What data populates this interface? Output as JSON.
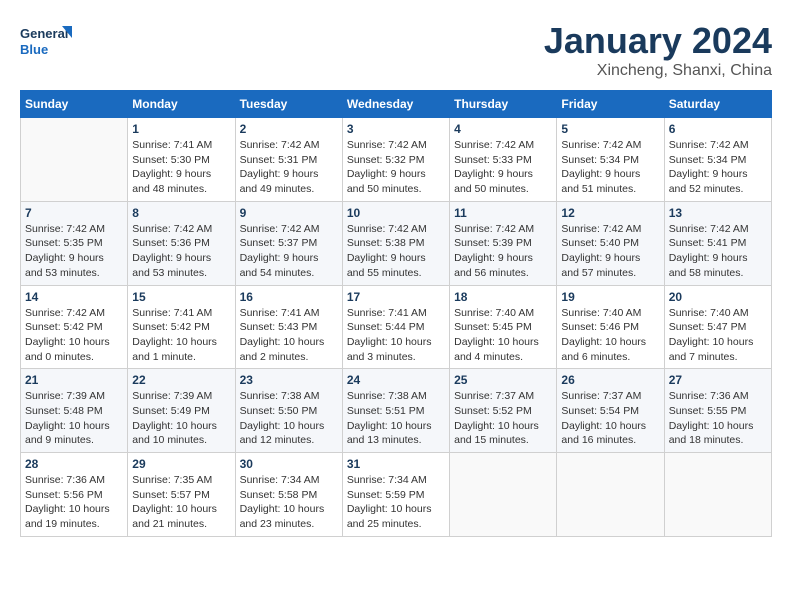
{
  "logo": {
    "general": "General",
    "blue": "Blue"
  },
  "title": "January 2024",
  "location": "Xincheng, Shanxi, China",
  "days_of_week": [
    "Sunday",
    "Monday",
    "Tuesday",
    "Wednesday",
    "Thursday",
    "Friday",
    "Saturday"
  ],
  "weeks": [
    [
      {
        "day": "",
        "info": ""
      },
      {
        "day": "1",
        "info": "Sunrise: 7:41 AM\nSunset: 5:30 PM\nDaylight: 9 hours\nand 48 minutes."
      },
      {
        "day": "2",
        "info": "Sunrise: 7:42 AM\nSunset: 5:31 PM\nDaylight: 9 hours\nand 49 minutes."
      },
      {
        "day": "3",
        "info": "Sunrise: 7:42 AM\nSunset: 5:32 PM\nDaylight: 9 hours\nand 50 minutes."
      },
      {
        "day": "4",
        "info": "Sunrise: 7:42 AM\nSunset: 5:33 PM\nDaylight: 9 hours\nand 50 minutes."
      },
      {
        "day": "5",
        "info": "Sunrise: 7:42 AM\nSunset: 5:34 PM\nDaylight: 9 hours\nand 51 minutes."
      },
      {
        "day": "6",
        "info": "Sunrise: 7:42 AM\nSunset: 5:34 PM\nDaylight: 9 hours\nand 52 minutes."
      }
    ],
    [
      {
        "day": "7",
        "info": "Sunrise: 7:42 AM\nSunset: 5:35 PM\nDaylight: 9 hours\nand 53 minutes."
      },
      {
        "day": "8",
        "info": "Sunrise: 7:42 AM\nSunset: 5:36 PM\nDaylight: 9 hours\nand 53 minutes."
      },
      {
        "day": "9",
        "info": "Sunrise: 7:42 AM\nSunset: 5:37 PM\nDaylight: 9 hours\nand 54 minutes."
      },
      {
        "day": "10",
        "info": "Sunrise: 7:42 AM\nSunset: 5:38 PM\nDaylight: 9 hours\nand 55 minutes."
      },
      {
        "day": "11",
        "info": "Sunrise: 7:42 AM\nSunset: 5:39 PM\nDaylight: 9 hours\nand 56 minutes."
      },
      {
        "day": "12",
        "info": "Sunrise: 7:42 AM\nSunset: 5:40 PM\nDaylight: 9 hours\nand 57 minutes."
      },
      {
        "day": "13",
        "info": "Sunrise: 7:42 AM\nSunset: 5:41 PM\nDaylight: 9 hours\nand 58 minutes."
      }
    ],
    [
      {
        "day": "14",
        "info": "Sunrise: 7:42 AM\nSunset: 5:42 PM\nDaylight: 10 hours\nand 0 minutes."
      },
      {
        "day": "15",
        "info": "Sunrise: 7:41 AM\nSunset: 5:42 PM\nDaylight: 10 hours\nand 1 minute."
      },
      {
        "day": "16",
        "info": "Sunrise: 7:41 AM\nSunset: 5:43 PM\nDaylight: 10 hours\nand 2 minutes."
      },
      {
        "day": "17",
        "info": "Sunrise: 7:41 AM\nSunset: 5:44 PM\nDaylight: 10 hours\nand 3 minutes."
      },
      {
        "day": "18",
        "info": "Sunrise: 7:40 AM\nSunset: 5:45 PM\nDaylight: 10 hours\nand 4 minutes."
      },
      {
        "day": "19",
        "info": "Sunrise: 7:40 AM\nSunset: 5:46 PM\nDaylight: 10 hours\nand 6 minutes."
      },
      {
        "day": "20",
        "info": "Sunrise: 7:40 AM\nSunset: 5:47 PM\nDaylight: 10 hours\nand 7 minutes."
      }
    ],
    [
      {
        "day": "21",
        "info": "Sunrise: 7:39 AM\nSunset: 5:48 PM\nDaylight: 10 hours\nand 9 minutes."
      },
      {
        "day": "22",
        "info": "Sunrise: 7:39 AM\nSunset: 5:49 PM\nDaylight: 10 hours\nand 10 minutes."
      },
      {
        "day": "23",
        "info": "Sunrise: 7:38 AM\nSunset: 5:50 PM\nDaylight: 10 hours\nand 12 minutes."
      },
      {
        "day": "24",
        "info": "Sunrise: 7:38 AM\nSunset: 5:51 PM\nDaylight: 10 hours\nand 13 minutes."
      },
      {
        "day": "25",
        "info": "Sunrise: 7:37 AM\nSunset: 5:52 PM\nDaylight: 10 hours\nand 15 minutes."
      },
      {
        "day": "26",
        "info": "Sunrise: 7:37 AM\nSunset: 5:54 PM\nDaylight: 10 hours\nand 16 minutes."
      },
      {
        "day": "27",
        "info": "Sunrise: 7:36 AM\nSunset: 5:55 PM\nDaylight: 10 hours\nand 18 minutes."
      }
    ],
    [
      {
        "day": "28",
        "info": "Sunrise: 7:36 AM\nSunset: 5:56 PM\nDaylight: 10 hours\nand 19 minutes."
      },
      {
        "day": "29",
        "info": "Sunrise: 7:35 AM\nSunset: 5:57 PM\nDaylight: 10 hours\nand 21 minutes."
      },
      {
        "day": "30",
        "info": "Sunrise: 7:34 AM\nSunset: 5:58 PM\nDaylight: 10 hours\nand 23 minutes."
      },
      {
        "day": "31",
        "info": "Sunrise: 7:34 AM\nSunset: 5:59 PM\nDaylight: 10 hours\nand 25 minutes."
      },
      {
        "day": "",
        "info": ""
      },
      {
        "day": "",
        "info": ""
      },
      {
        "day": "",
        "info": ""
      }
    ]
  ]
}
